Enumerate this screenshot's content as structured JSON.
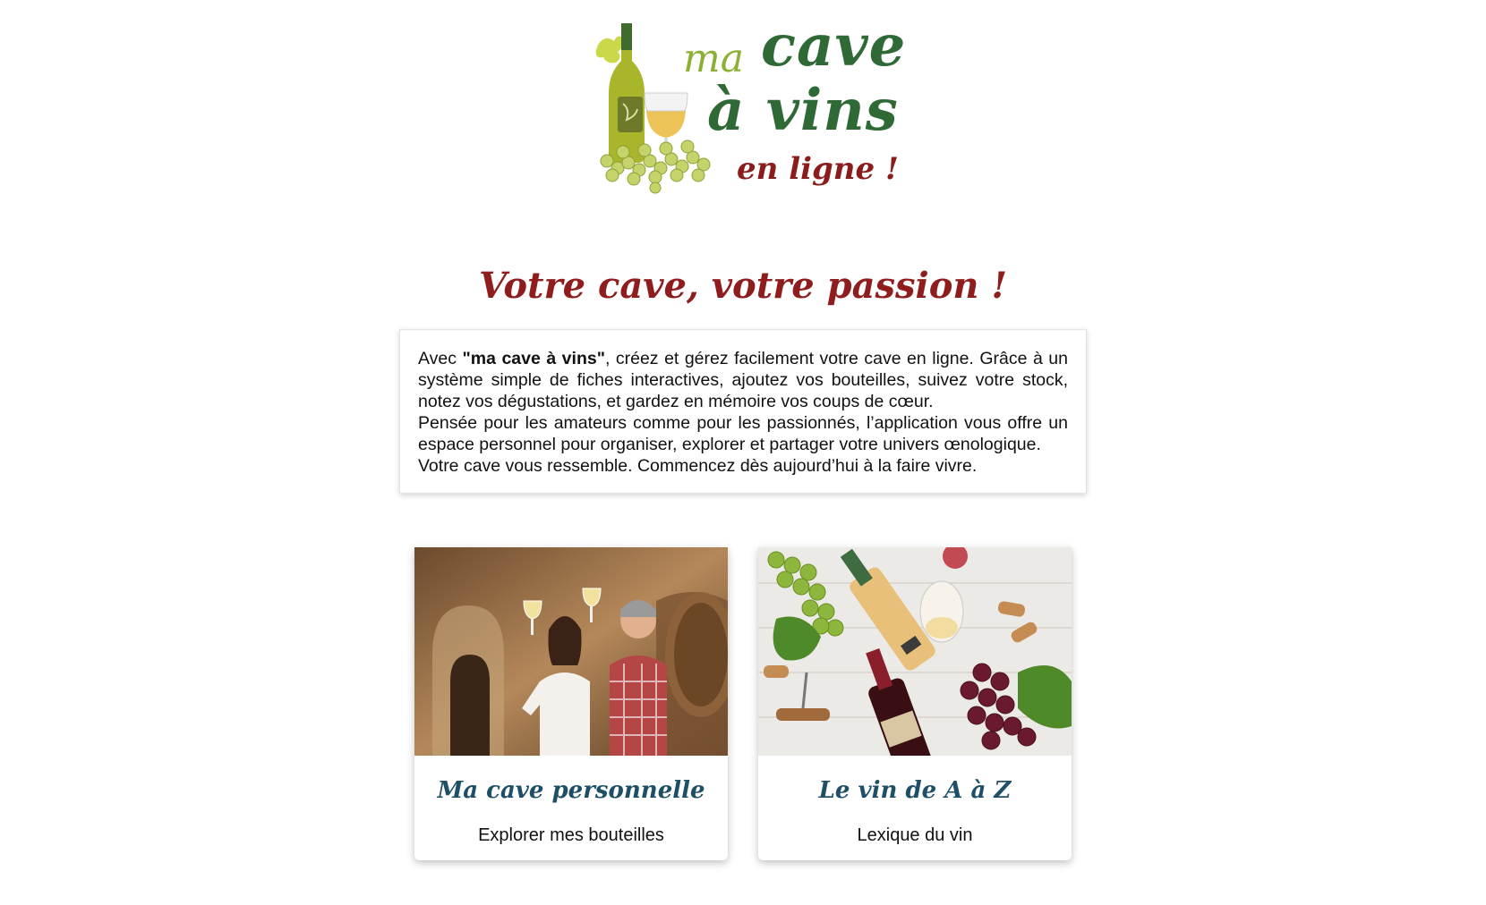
{
  "logo": {
    "ma": "ma",
    "cave": "cave",
    "a_vins": "à vins",
    "en_ligne": "en ligne !"
  },
  "tagline": "Votre cave, votre passion !",
  "intro": {
    "prefix": "Avec ",
    "brand": "\"ma cave à vins\"",
    "sentence1_rest": ", créez et gérez facilement votre cave en ligne. Grâce à un système simple de fiches interactives, ajoutez vos bouteilles, suivez votre stock, notez vos dégustations, et gardez en mémoire vos coups de cœur.",
    "sentence2": "Pensée pour les amateurs comme pour les passionnés, l’application vous offre un espace personnel pour organiser, explorer et partager votre univers œnologique.",
    "sentence3": "Votre cave vous ressemble. Commencez dès aujourd’hui à la faire vivre."
  },
  "cards": [
    {
      "title": "Ma cave personnelle",
      "subtitle": "Explorer mes bouteilles"
    },
    {
      "title": "Le vin de A à Z",
      "subtitle": "Lexique du vin"
    }
  ],
  "colors": {
    "tagline": "#8f1d1d",
    "card_title": "#1e4f66",
    "logo_green": "#2f6a36",
    "logo_light_green": "#8bb034",
    "logo_red": "#8b1c1c"
  }
}
